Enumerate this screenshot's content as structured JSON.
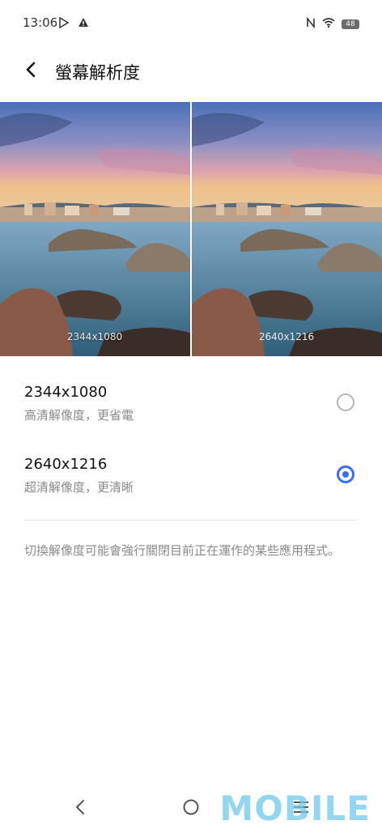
{
  "status_bar": {
    "time": "13:06",
    "battery": "48",
    "icons": [
      "play-store-icon",
      "warning-icon",
      "nfc-icon",
      "wifi-icon",
      "battery-icon"
    ]
  },
  "header": {
    "title": "螢幕解析度",
    "back_icon": "back-arrow-icon"
  },
  "preview": {
    "left_caption": "2344x1080",
    "right_caption": "2640x1216"
  },
  "options": [
    {
      "title": "2344x1080",
      "subtitle": "高清解像度，更省電",
      "selected": false
    },
    {
      "title": "2640x1216",
      "subtitle": "超清解像度，更清晰",
      "selected": true
    }
  ],
  "note": "切換解像度可能會強行關閉目前正在運作的某些應用程式。",
  "nav": {
    "icons": [
      "nav-back-icon",
      "nav-home-icon",
      "nav-menu-icon"
    ],
    "watermark": "MOBILE"
  },
  "colors": {
    "accent": "#3a6cf4",
    "radio_off": "#b5b5b5",
    "secondary_text": "#8a8a8a"
  }
}
